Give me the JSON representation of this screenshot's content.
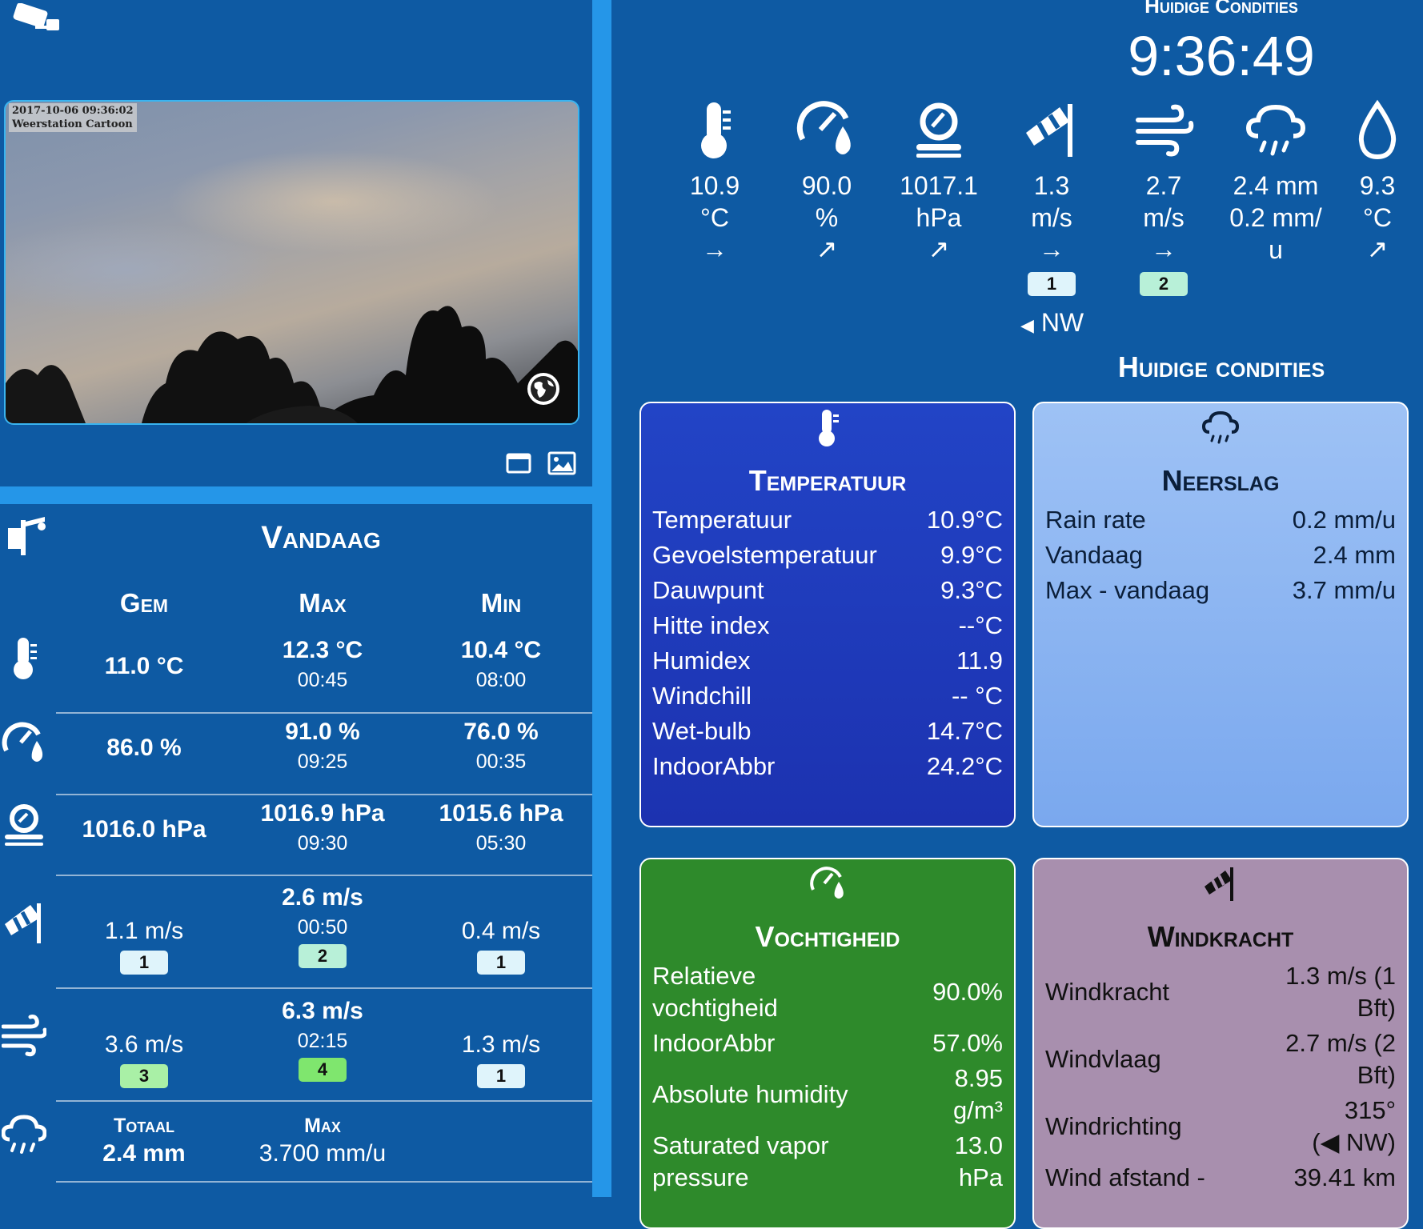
{
  "webcam": {
    "timestamp": "2017-10-06 09:36:02",
    "caption": "Weerstation Cartoon"
  },
  "today": {
    "title": "Vandaag",
    "headers": {
      "avg": "Gem",
      "max": "Max",
      "min": "Min"
    },
    "temperature": {
      "avg": "11.0 °C",
      "max": "12.3 °C",
      "max_time": "00:45",
      "min": "10.4 °C",
      "min_time": "08:00"
    },
    "humidity": {
      "avg": "86.0 %",
      "max": "91.0 %",
      "max_time": "09:25",
      "min": "76.0 %",
      "min_time": "00:35"
    },
    "pressure": {
      "avg": "1016.0 hPa",
      "max": "1016.9 hPa",
      "max_time": "09:30",
      "min": "1015.6 hPa",
      "min_time": "05:30"
    },
    "wind_speed": {
      "avg": "1.1 m/s",
      "avg_bft": "1",
      "max": "2.6 m/s",
      "max_time": "00:50",
      "max_bft": "2",
      "min": "0.4 m/s",
      "min_bft": "1"
    },
    "wind_gust": {
      "avg": "3.6 m/s",
      "avg_bft": "3",
      "max": "6.3 m/s",
      "max_time": "02:15",
      "max_bft": "4",
      "min": "1.3 m/s",
      "min_bft": "1"
    },
    "rain": {
      "total_label": "Totaal",
      "total": "2.4 mm",
      "max_label": "Max",
      "max": "3.700 mm/u"
    }
  },
  "current": {
    "header": "Huidige Condities",
    "clock": "9:36:49",
    "temperature": {
      "value": "10.9",
      "unit": "°C",
      "trend": "→"
    },
    "humidity": {
      "value": "90.0",
      "unit": "%",
      "trend": "↗"
    },
    "pressure": {
      "value": "1017.1",
      "unit": "hPa",
      "trend": "↗"
    },
    "wind_speed": {
      "value": "1.3",
      "unit": "m/s",
      "trend": "→",
      "bft": "1",
      "direction": "NW"
    },
    "wind_gust": {
      "value": "2.7",
      "unit": "m/s",
      "trend": "→",
      "bft": "2"
    },
    "rain": {
      "value": "2.4 mm",
      "rate_a": "0.2 mm/",
      "rate_b": "u"
    },
    "dewpoint": {
      "value": "9.3",
      "unit": "°C",
      "trend": "↗"
    },
    "section_title": "Huidige condities"
  },
  "panels": {
    "temperature": {
      "title": "Temperatuur",
      "rows": [
        {
          "label": "Temperatuur",
          "value": "10.9°C"
        },
        {
          "label": "Gevoelstemperatuur",
          "value": "9.9°C"
        },
        {
          "label": "Dauwpunt",
          "value": "9.3°C"
        },
        {
          "label": "Hitte index",
          "value": "--°C"
        },
        {
          "label": "Humidex",
          "value": "11.9"
        },
        {
          "label": "Windchill",
          "value": "-- °C"
        },
        {
          "label": "Wet-bulb",
          "value": "14.7°C"
        },
        {
          "label": "IndoorAbbr",
          "value": "24.2°C"
        }
      ]
    },
    "rain": {
      "title": "Neerslag",
      "rows": [
        {
          "label": "Rain rate",
          "value": "0.2 mm/u"
        },
        {
          "label": "Vandaag",
          "value": "2.4 mm"
        },
        {
          "label": "Max - vandaag",
          "value": "3.7 mm/u"
        }
      ]
    },
    "humidity": {
      "title": "Vochtigheid",
      "rows": [
        {
          "label": "Relatieve vochtigheid",
          "value": "90.0%"
        },
        {
          "label": "IndoorAbbr",
          "value": "57.0%"
        },
        {
          "label": "Absolute humidity",
          "value_a": "8.95",
          "value_b": "g/m³"
        },
        {
          "label_a": "Saturated vapor",
          "label_b": "pressure",
          "value": "13.0 hPa"
        }
      ]
    },
    "wind": {
      "title": "Windkracht",
      "rows": [
        {
          "label": "Windkracht",
          "value_a": "1.3 m/s (1",
          "value_b": "Bft)"
        },
        {
          "label": "Windvlaag",
          "value_a": "2.7 m/s (2",
          "value_b": "Bft)"
        },
        {
          "label": "Windrichting",
          "value_a": "315°",
          "value_b": "(◀ NW)"
        },
        {
          "label": "Wind afstand -",
          "value": "39.41 km"
        }
      ]
    }
  },
  "colors": {
    "background": "#0e5aa3",
    "divider": "#2596e8",
    "bft1": "#dff4fb",
    "bft2": "#b8f0d8",
    "bft3": "#a9f0a6",
    "bft4": "#7fe66e",
    "temp_panel": "#2244c6",
    "rain_panel": "#9ec2f5",
    "humidity_panel": "#2e8a2b",
    "wind_panel": "#a88fae"
  },
  "icons": [
    "webcam-icon",
    "globe-icon",
    "window-icon",
    "image-icon",
    "weather-station-icon",
    "thermometer-icon",
    "humidity-gauge-icon",
    "barometer-icon",
    "windsock-icon",
    "wind-gust-icon",
    "rain-cloud-icon",
    "droplet-icon"
  ]
}
